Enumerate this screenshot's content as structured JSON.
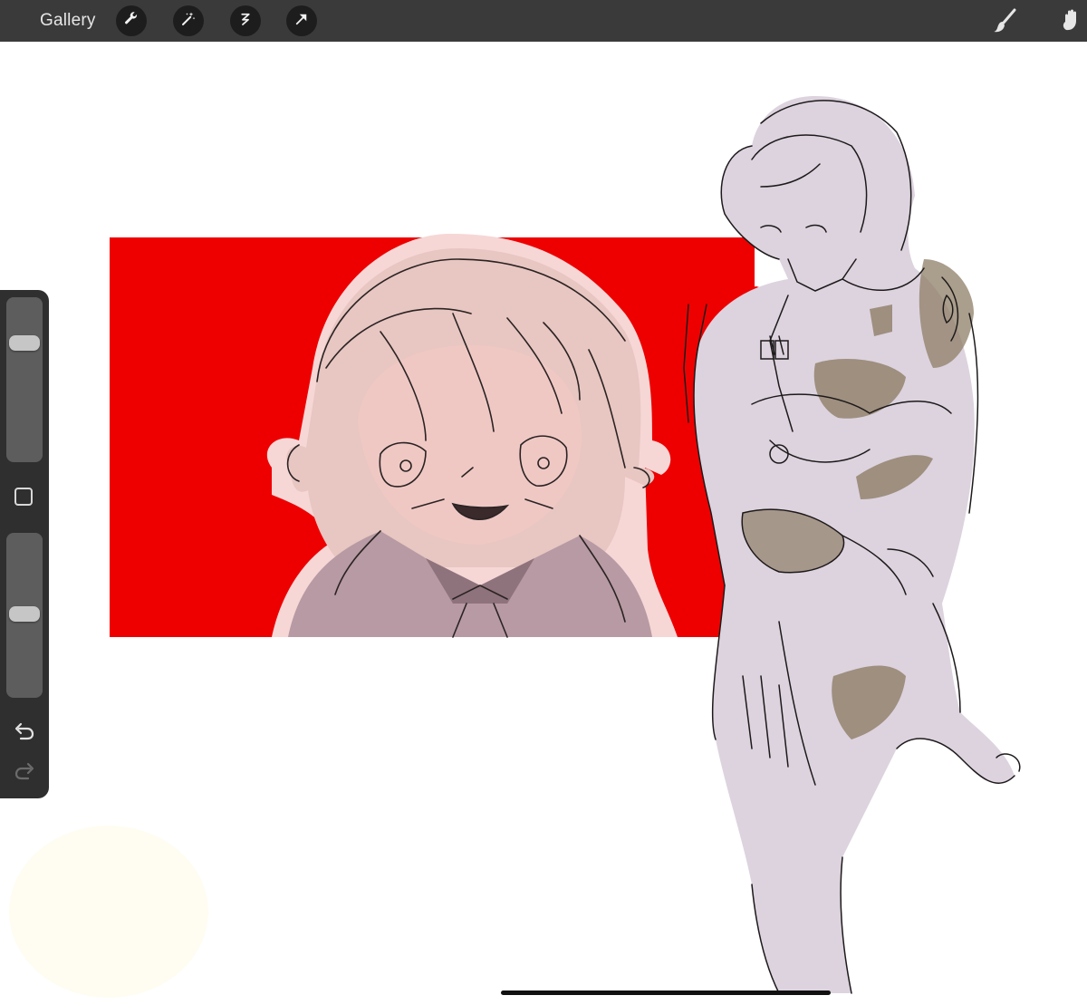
{
  "toolbar": {
    "gallery_label": "Gallery",
    "left_tools": [
      "wrench-icon",
      "magic-wand-icon",
      "selection-icon",
      "transform-arrow-icon"
    ],
    "right_tools": [
      "brush-icon",
      "smudge-icon"
    ]
  },
  "sidebar": {
    "brush_size_level": 0.76,
    "opacity_level": 0.51,
    "icons": [
      "modify-square-icon",
      "undo-icon",
      "redo-icon"
    ]
  },
  "colors": {
    "toolbar_bg": "#3a3a3a",
    "canvas_bg": "#ffffff",
    "red_panel": "#ee0000",
    "skin_pink": "#efc4c0",
    "uniform_mauve": "#b89ea6",
    "suit_lavender": "#ddd2de",
    "brown_shading": "#8e7e66"
  }
}
